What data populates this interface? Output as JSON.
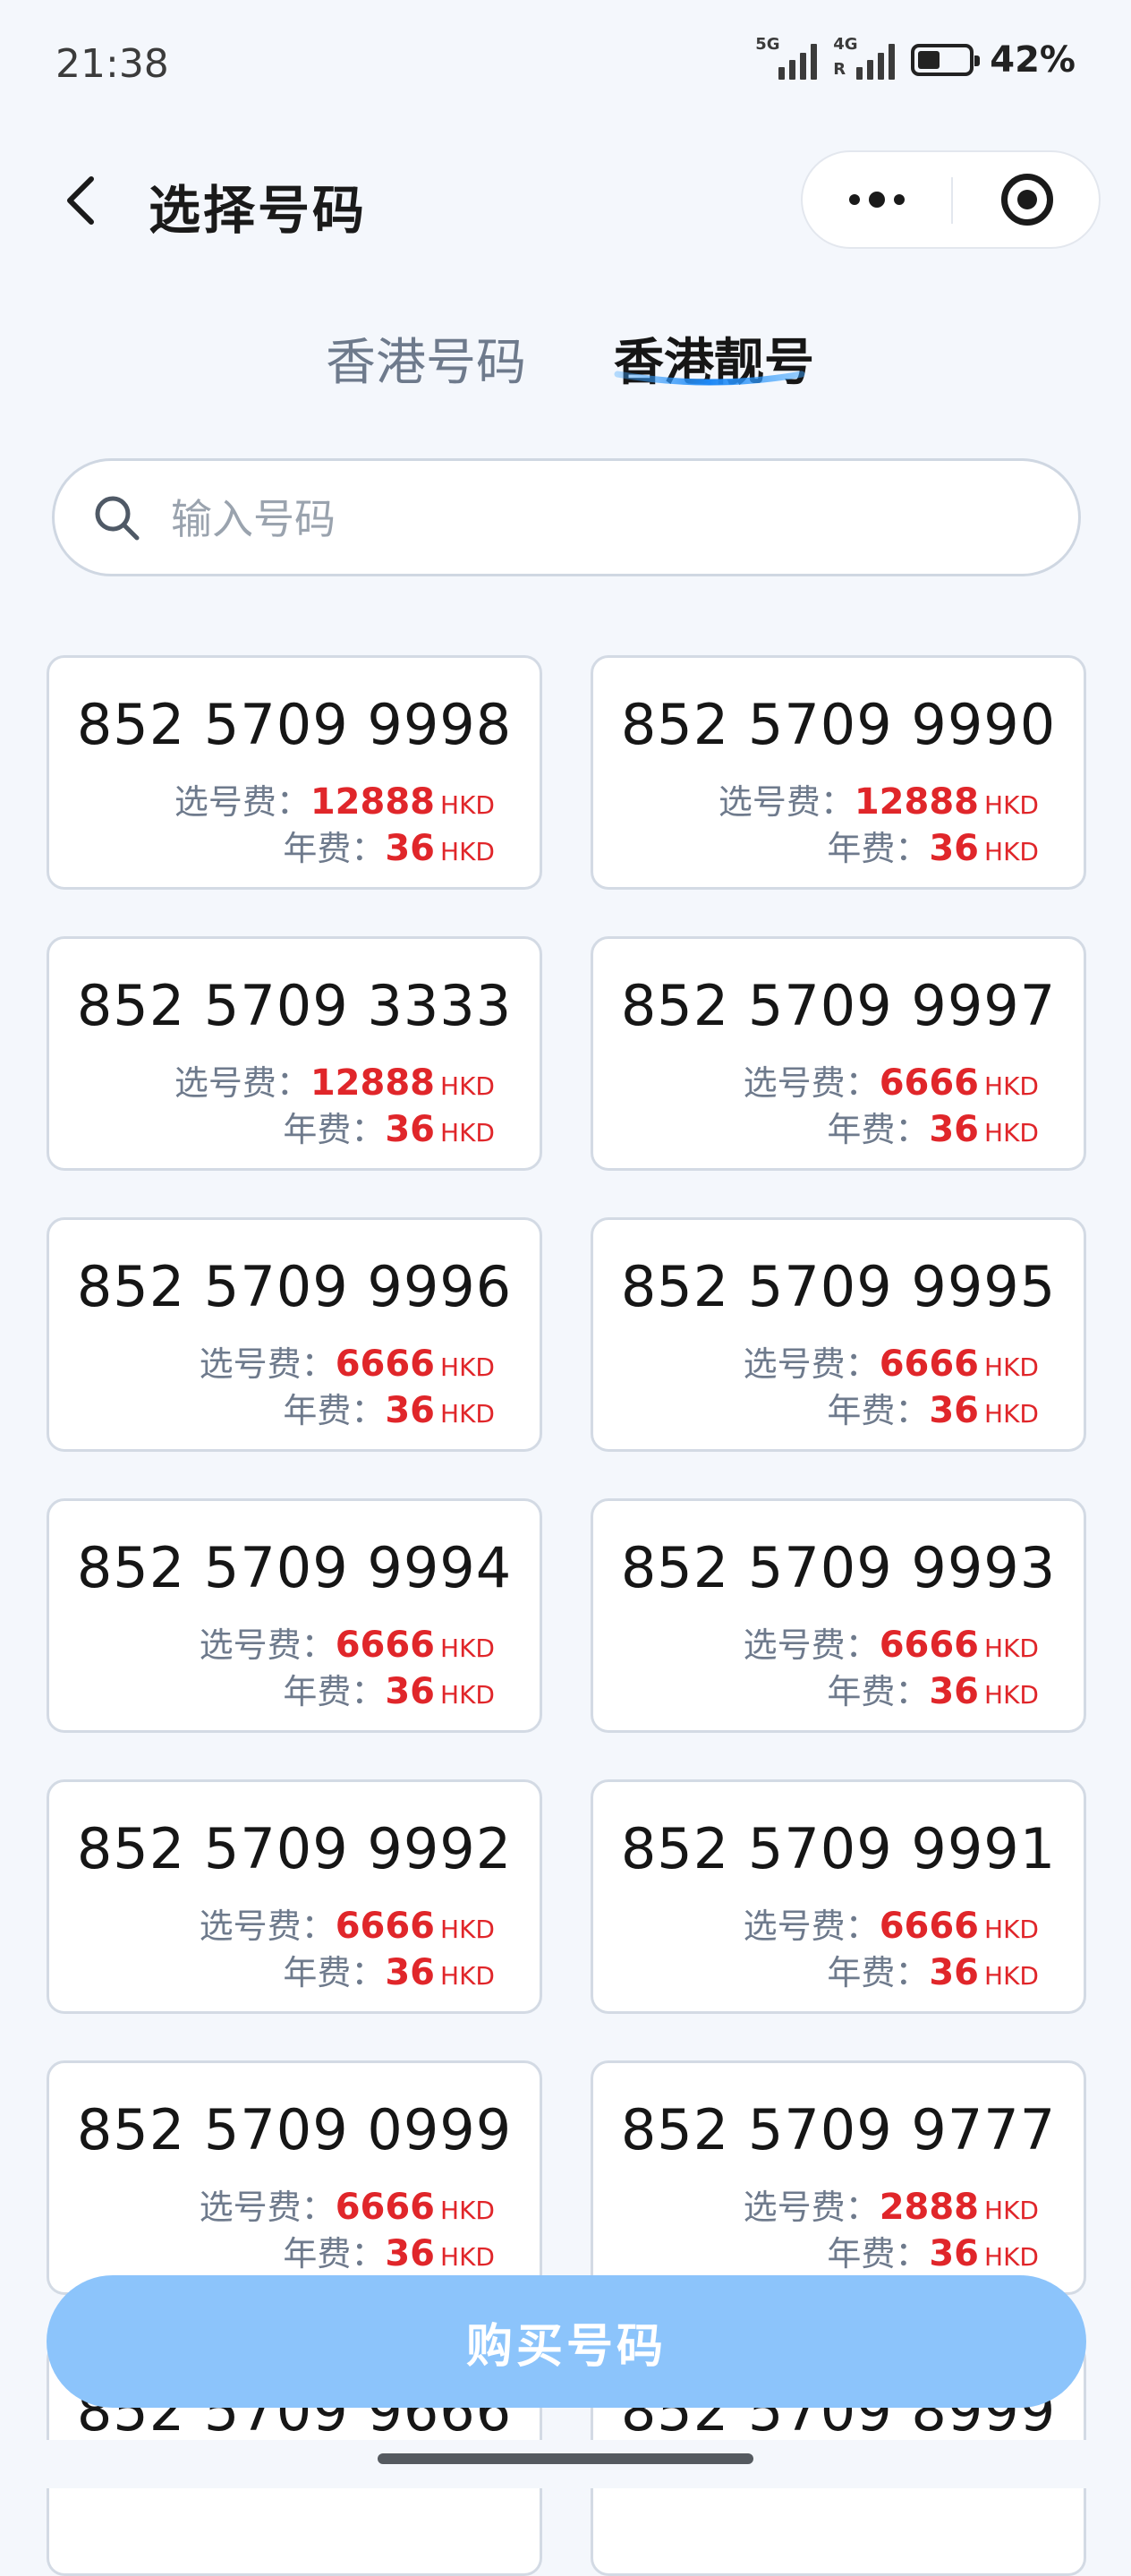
{
  "status_bar": {
    "time": "21:38",
    "sim1": "5G",
    "sim2": "4G",
    "sim2_roaming": "R",
    "battery": "42%"
  },
  "nav": {
    "title": "选择号码"
  },
  "tabs": [
    {
      "label": "香港号码",
      "active": false
    },
    {
      "label": "香港靓号",
      "active": true
    }
  ],
  "search": {
    "placeholder": "输入号码",
    "value": ""
  },
  "fee_labels": {
    "selection": "选号费：",
    "annual": "年费：",
    "currency": "HKD"
  },
  "numbers": [
    {
      "number": "852 5709 9998",
      "selection_fee": "12888",
      "annual_fee": "36"
    },
    {
      "number": "852 5709 9990",
      "selection_fee": "12888",
      "annual_fee": "36"
    },
    {
      "number": "852 5709 3333",
      "selection_fee": "12888",
      "annual_fee": "36"
    },
    {
      "number": "852 5709 9997",
      "selection_fee": "6666",
      "annual_fee": "36"
    },
    {
      "number": "852 5709 9996",
      "selection_fee": "6666",
      "annual_fee": "36"
    },
    {
      "number": "852 5709 9995",
      "selection_fee": "6666",
      "annual_fee": "36"
    },
    {
      "number": "852 5709 9994",
      "selection_fee": "6666",
      "annual_fee": "36"
    },
    {
      "number": "852 5709 9993",
      "selection_fee": "6666",
      "annual_fee": "36"
    },
    {
      "number": "852 5709 9992",
      "selection_fee": "6666",
      "annual_fee": "36"
    },
    {
      "number": "852 5709 9991",
      "selection_fee": "6666",
      "annual_fee": "36"
    },
    {
      "number": "852 5709 0999",
      "selection_fee": "6666",
      "annual_fee": "36"
    },
    {
      "number": "852 5709 9777",
      "selection_fee": "2888",
      "annual_fee": "36"
    },
    {
      "number": "852 5709 9666",
      "selection_fee": "",
      "annual_fee": ""
    },
    {
      "number": "852 5709 8999",
      "selection_fee": "",
      "annual_fee": ""
    }
  ],
  "buy_button": {
    "label": "购买号码"
  },
  "colors": {
    "accent": "#1e88f5",
    "price_red": "#e0262a",
    "button_bg": "#8cc4fb",
    "page_bg": "#f4f7fc"
  }
}
